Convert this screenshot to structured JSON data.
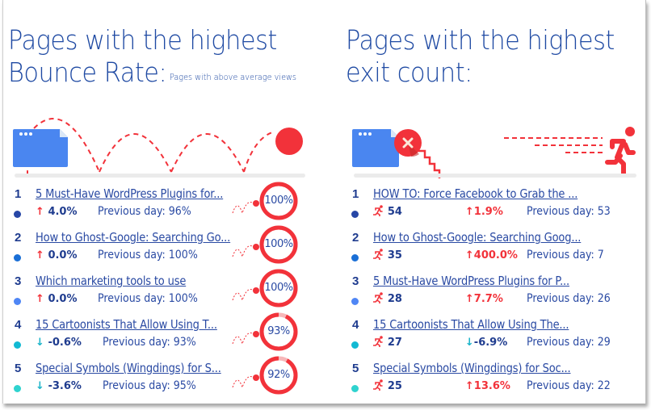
{
  "bounce": {
    "title_line1": "Pages with the highest",
    "title_line2": "Bounce Rate:",
    "subtitle": "Pages with above average views",
    "items": [
      {
        "rank": "1",
        "title": "5 Must-Have WordPress Plugins for...",
        "direction": "up",
        "arrow": "↑",
        "change": "4.0%",
        "previous": "Previous day: 96%",
        "rate": 100,
        "rate_label": "100%",
        "dot_color": "#2747a6"
      },
      {
        "rank": "2",
        "title": "How to Ghost-Google: Searching Go...",
        "direction": "up",
        "arrow": "↑",
        "change": "0.0%",
        "previous": "Previous day: 100%",
        "rate": 100,
        "rate_label": "100%",
        "dot_color": "#1a6fd6"
      },
      {
        "rank": "3",
        "title": "Which marketing tools to use",
        "direction": "up",
        "arrow": "↑",
        "change": "0.0%",
        "previous": "Previous day: 100%",
        "rate": 100,
        "rate_label": "100%",
        "dot_color": "#4f86f5"
      },
      {
        "rank": "4",
        "title": "15 Cartoonists That Allow Using T...",
        "direction": "down",
        "arrow": "↓",
        "change": "-0.6%",
        "previous": "Previous day: 93%",
        "rate": 93,
        "rate_label": "93%",
        "dot_color": "#12b9d3"
      },
      {
        "rank": "5",
        "title": "Special Symbols (Wingdings) for S...",
        "direction": "down",
        "arrow": "↓",
        "change": "-3.6%",
        "previous": "Previous day: 95%",
        "rate": 92,
        "rate_label": "92%",
        "dot_color": "#2fd3cf"
      }
    ]
  },
  "exit": {
    "title_line1": "Pages with the highest",
    "title_line2": "exit count:",
    "items": [
      {
        "rank": "1",
        "title": "HOW TO: Force Facebook to Grab the ...",
        "exits": "54",
        "direction": "up",
        "arrow": "↑",
        "change": "1.9%",
        "previous": "Previous day: 53",
        "dot_color": "#2747a6"
      },
      {
        "rank": "2",
        "title": "How to Ghost-Google: Searching Goog...",
        "exits": "35",
        "direction": "up",
        "arrow": "↑",
        "change": "400.0%",
        "previous": "Previous day: 7",
        "dot_color": "#1a6fd6"
      },
      {
        "rank": "3",
        "title": "5 Must-Have WordPress Plugins for P...",
        "exits": "28",
        "direction": "up",
        "arrow": "↑",
        "change": "7.7%",
        "previous": "Previous day: 26",
        "dot_color": "#4f86f5"
      },
      {
        "rank": "4",
        "title": "15 Cartoonists That Allow Using The...",
        "exits": "27",
        "direction": "down",
        "arrow": "↓",
        "change": "-6.9%",
        "previous": "Previous day: 29",
        "dot_color": "#12b9d3"
      },
      {
        "rank": "5",
        "title": "Special Symbols (Wingdings) for Soc...",
        "exits": "25",
        "direction": "up",
        "arrow": "↑",
        "change": "13.6%",
        "previous": "Previous day: 22",
        "dot_color": "#2fd3cf"
      }
    ]
  },
  "colors": {
    "title": "#1f4aa3",
    "accent_red": "#f2323a",
    "down_teal": "#1bb4c9",
    "browser_blue": "#4a86f0"
  },
  "icons": {
    "bounce_illustration": "browser-window-with-bouncing-ball",
    "exit_illustration": "browser-window-close-stairs-running-person",
    "exit_count_icon": "running-person-icon",
    "up_arrow": "arrow-up-icon",
    "down_arrow": "arrow-down-icon"
  }
}
